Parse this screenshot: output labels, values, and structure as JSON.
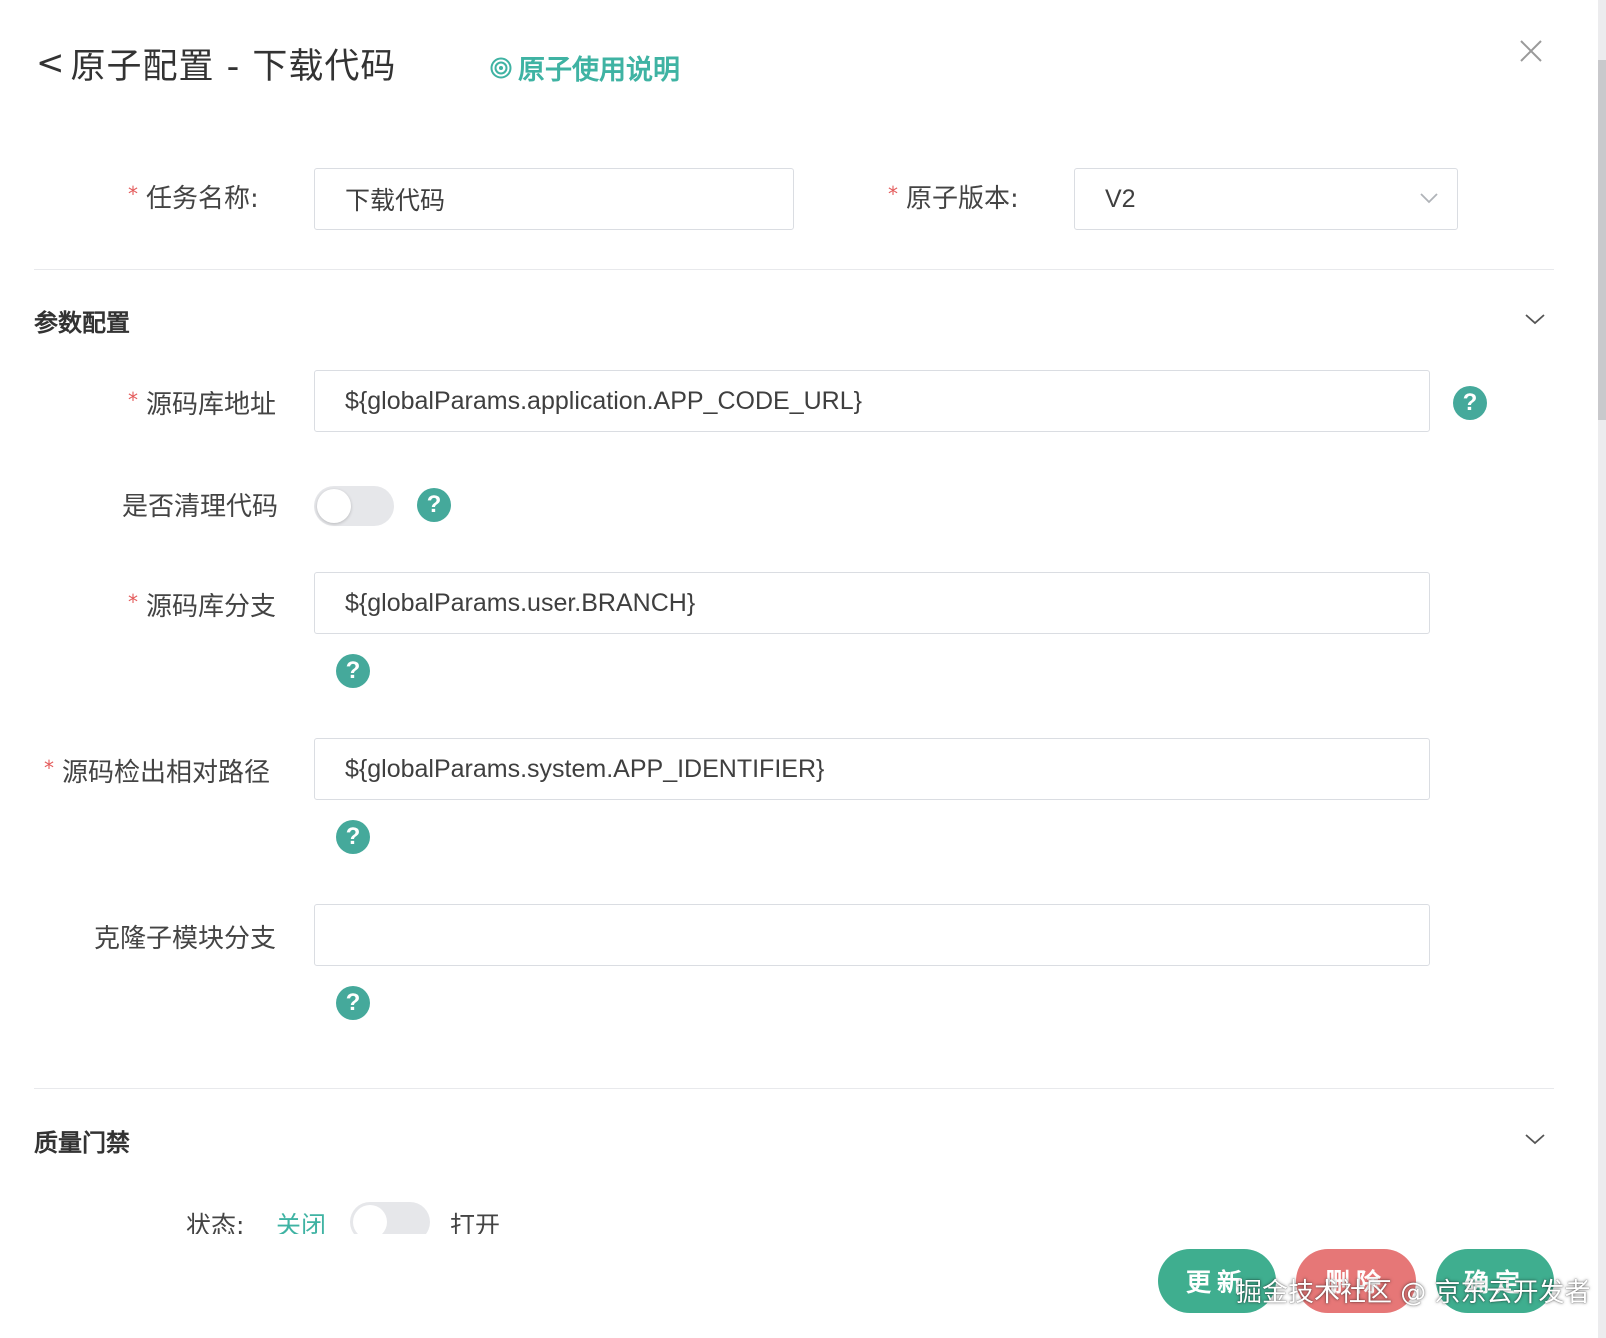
{
  "header": {
    "back_glyph": "<",
    "title": "原子配置 - 下载代码",
    "usage_link": "原子使用说明"
  },
  "task": {
    "name_label": "任务名称:",
    "name_value": "下载代码",
    "version_label": "原子版本:",
    "version_value": "V2"
  },
  "params": {
    "section_title": "参数配置",
    "repo_url_label": "源码库地址",
    "repo_url_value": "${globalParams.application.APP_CODE_URL}",
    "clean_label": "是否清理代码",
    "clean_enabled": false,
    "branch_label": "源码库分支",
    "branch_value": "${globalParams.user.BRANCH}",
    "checkout_path_label": "源码检出相对路径",
    "checkout_path_value": "${globalParams.system.APP_IDENTIFIER}",
    "submodule_label": "克隆子模块分支",
    "submodule_value": ""
  },
  "quality": {
    "section_title": "质量门禁",
    "status_label": "状态:",
    "off_label": "关闭",
    "on_label": "打开",
    "enabled": false
  },
  "footer": {
    "update_label": "更新",
    "delete_label": "删除",
    "confirm_label": "确定"
  },
  "watermark": "掘金技术社区 @ 京东云开发者",
  "colors": {
    "accent": "#3fb3a3",
    "help": "#45a99b",
    "required": "#e45b5b",
    "button_green": "#3fae8f",
    "button_red": "#e67777"
  }
}
